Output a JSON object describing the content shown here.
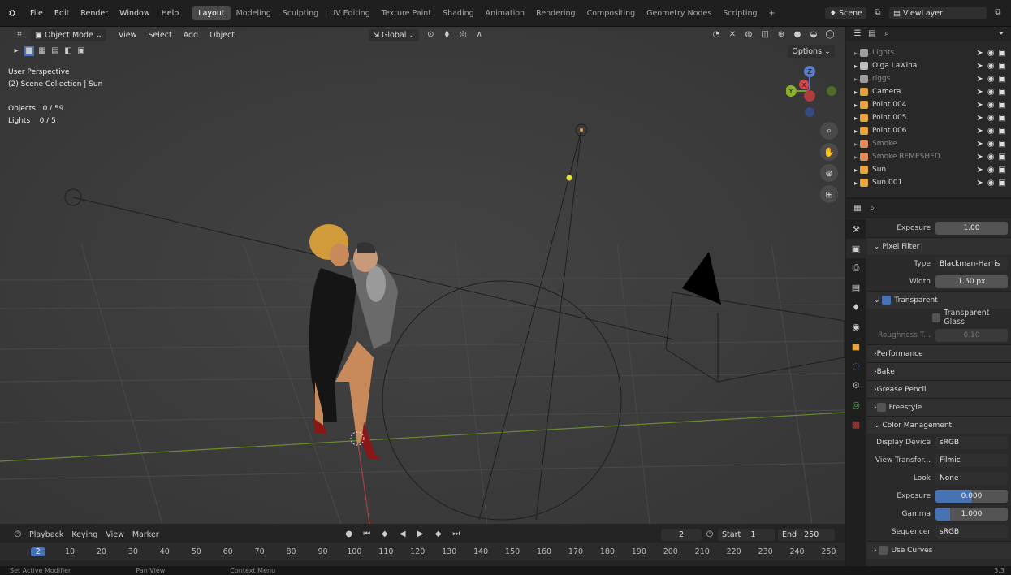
{
  "topbar": {
    "menus": [
      "File",
      "Edit",
      "Render",
      "Window",
      "Help"
    ],
    "workspaces": [
      "Layout",
      "Modeling",
      "Sculpting",
      "UV Editing",
      "Texture Paint",
      "Shading",
      "Animation",
      "Rendering",
      "Compositing",
      "Geometry Nodes",
      "Scripting",
      "+"
    ],
    "active_workspace": "Layout",
    "scene": "Scene",
    "view_layer": "ViewLayer"
  },
  "viewport": {
    "mode": "Object Mode",
    "menus": [
      "View",
      "Select",
      "Add",
      "Object"
    ],
    "orientation": "Global",
    "options": "Options",
    "info": [
      "User Perspective",
      "(2) Scene Collection | Sun",
      "",
      "Objects   0 / 59",
      "Lights    0 / 5"
    ],
    "gizmo": {
      "z": "Z",
      "y": "Y",
      "x": "X"
    }
  },
  "timeline": {
    "menus": [
      "Playback",
      "Keying",
      "View",
      "Marker"
    ],
    "current_frame": "2",
    "start_label": "Start",
    "start": "1",
    "end_label": "End",
    "end": "250",
    "ticks": [
      "2",
      "10",
      "20",
      "30",
      "40",
      "50",
      "60",
      "70",
      "80",
      "90",
      "100",
      "110",
      "120",
      "130",
      "140",
      "150",
      "160",
      "170",
      "180",
      "190",
      "200",
      "210",
      "220",
      "230",
      "240",
      "250"
    ]
  },
  "status": {
    "left": "Set Active Modifier",
    "mid": "Pan View",
    "right": "Context Menu",
    "version": "3.3"
  },
  "outliner": {
    "rows": [
      {
        "name": "Lights",
        "color": "#9a9a9a",
        "dim": true
      },
      {
        "name": "Olga Lawina",
        "color": "#bdbdbd",
        "dim": false
      },
      {
        "name": "riggs",
        "color": "#9a9a9a",
        "dim": true
      },
      {
        "name": "Camera",
        "color": "#e0a040",
        "dim": false
      },
      {
        "name": "Point.004",
        "color": "#e8a43c",
        "dim": false
      },
      {
        "name": "Point.005",
        "color": "#e8a43c",
        "dim": false
      },
      {
        "name": "Point.006",
        "color": "#e8a43c",
        "dim": false
      },
      {
        "name": "Smoke",
        "color": "#e08a5a",
        "dim": true
      },
      {
        "name": "Smoke REMESHED",
        "color": "#e08a5a",
        "dim": true
      },
      {
        "name": "Sun",
        "color": "#e8a43c",
        "dim": false
      },
      {
        "name": "Sun.001",
        "color": "#e8a43c",
        "dim": false
      }
    ]
  },
  "properties": {
    "exposure_label": "Exposure",
    "exposure": "1.00",
    "pixel_filter": "Pixel Filter",
    "type_label": "Type",
    "type": "Blackman-Harris",
    "width_label": "Width",
    "width": "1.50 px",
    "transparent": "Transparent",
    "transparent_glass": "Transparent Glass",
    "roughness_label": "Roughness T...",
    "roughness": "0.10",
    "sections": [
      "Performance",
      "Bake",
      "Grease Pencil",
      "Freestyle"
    ],
    "color_mgmt": "Color Management",
    "display_device_label": "Display Device",
    "display_device": "sRGB",
    "view_transform_label": "View Transfor...",
    "view_transform": "Filmic",
    "look_label": "Look",
    "look": "None",
    "cm_exposure_label": "Exposure",
    "cm_exposure": "0.000",
    "gamma_label": "Gamma",
    "gamma": "1.000",
    "sequencer_label": "Sequencer",
    "sequencer": "sRGB",
    "use_curves": "Use Curves"
  },
  "colors": {
    "accent": "#4772b3",
    "viewport_bg": "#3c3c3c",
    "panel_bg": "#2a2a2a"
  }
}
